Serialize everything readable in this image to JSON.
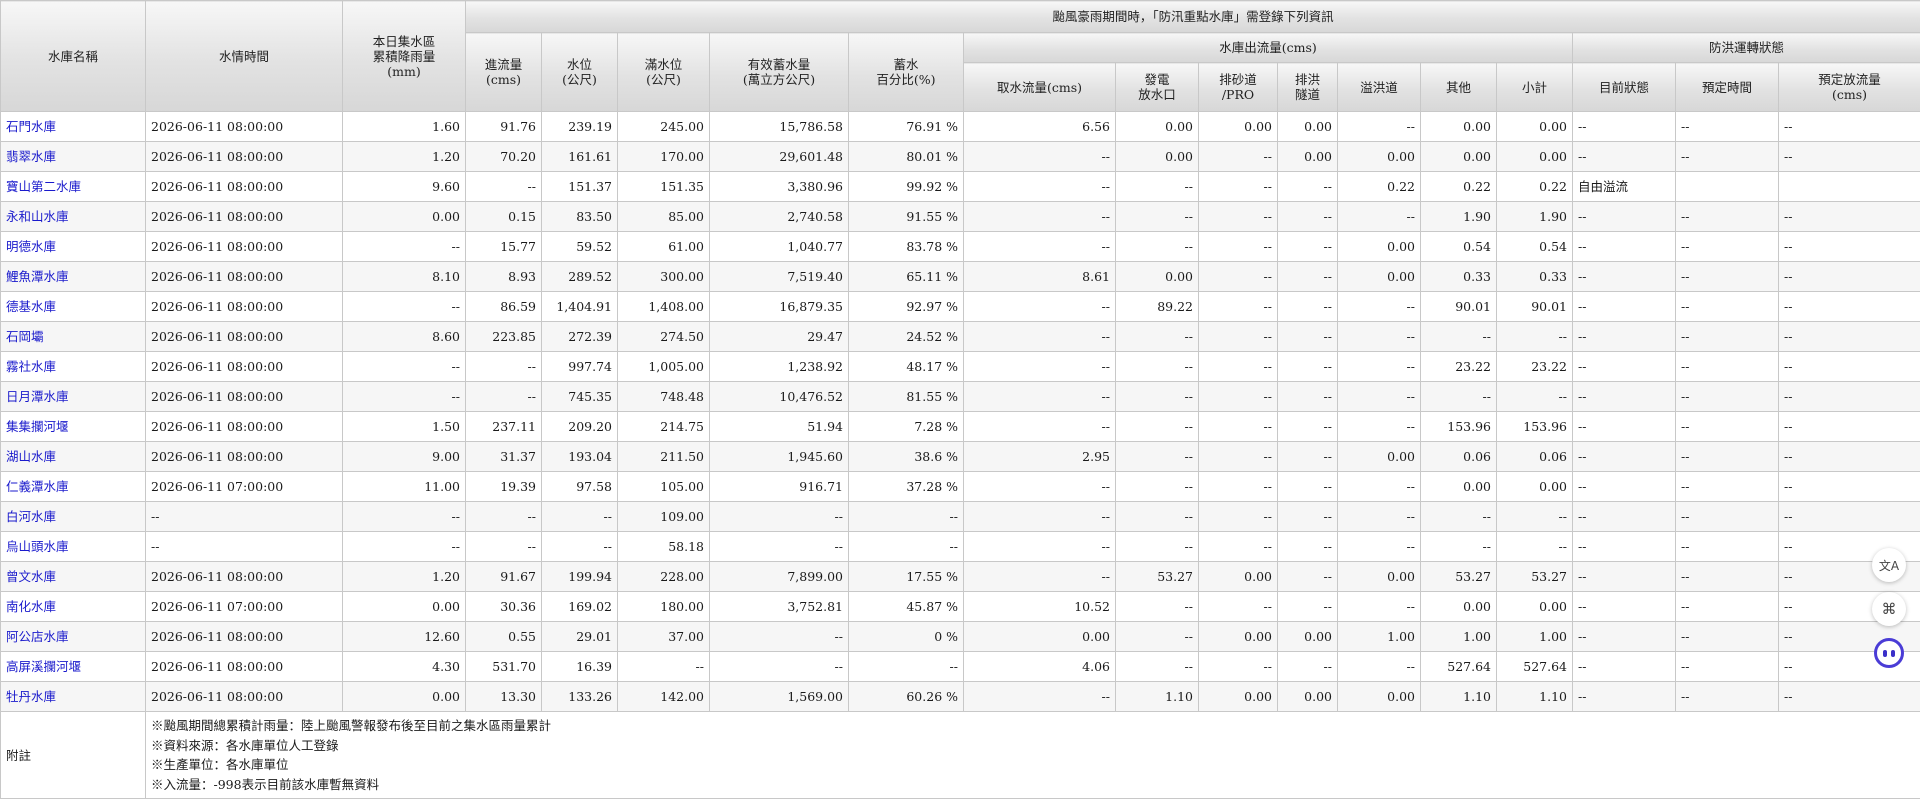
{
  "header": {
    "reservoir_name": "水庫名稱",
    "water_time": "水情時間",
    "rainfall": "本日集水區\n累積降雨量\n(mm)",
    "typhoon_banner": "颱風豪雨期間時，「防汛重點水庫」需登錄下列資訊",
    "inflow": "進流量\n(cms)",
    "water_level": "水位\n(公尺)",
    "full_level": "滿水位\n(公尺)",
    "effective_storage": "有效蓄水量\n(萬立方公尺)",
    "storage_pct": "蓄水\n百分比(%)",
    "outflow_group": "水庫出流量(cms)",
    "intake_flow": "取水流量(cms)",
    "power_outlet": "發電\n放水口",
    "sediment_pro": "排砂道\n/PRO",
    "flood_tunnel": "排洪\n隧道",
    "spillway": "溢洪道",
    "others": "其他",
    "subtotal": "小計",
    "flood_ops_group": "防洪運轉狀態",
    "current_status": "目前狀態",
    "scheduled_time": "預定時間",
    "scheduled_discharge": "預定放流量\n(cms)"
  },
  "rows": [
    {
      "name": "石門水庫",
      "time": "2026-06-11 08:00:00",
      "rain": "1.60",
      "inflow": "91.76",
      "level": "239.19",
      "full": "245.00",
      "storage": "15,786.58",
      "pct": "76.91 %",
      "intake": "6.56",
      "power": "0.00",
      "sediment": "0.00",
      "tunnel": "0.00",
      "spill": "--",
      "other": "0.00",
      "subtotal": "0.00",
      "status": "--",
      "sched_time": "--",
      "sched_flow": "--"
    },
    {
      "name": "翡翠水庫",
      "time": "2026-06-11 08:00:00",
      "rain": "1.20",
      "inflow": "70.20",
      "level": "161.61",
      "full": "170.00",
      "storage": "29,601.48",
      "pct": "80.01 %",
      "intake": "--",
      "power": "0.00",
      "sediment": "--",
      "tunnel": "0.00",
      "spill": "0.00",
      "other": "0.00",
      "subtotal": "0.00",
      "status": "--",
      "sched_time": "--",
      "sched_flow": "--"
    },
    {
      "name": "寶山第二水庫",
      "time": "2026-06-11 08:00:00",
      "rain": "9.60",
      "inflow": "--",
      "level": "151.37",
      "full": "151.35",
      "storage": "3,380.96",
      "pct": "99.92 %",
      "intake": "--",
      "power": "--",
      "sediment": "--",
      "tunnel": "--",
      "spill": "0.22",
      "other": "0.22",
      "subtotal": "0.22",
      "status": "自由溢流",
      "sched_time": "",
      "sched_flow": ""
    },
    {
      "name": "永和山水庫",
      "time": "2026-06-11 08:00:00",
      "rain": "0.00",
      "inflow": "0.15",
      "level": "83.50",
      "full": "85.00",
      "storage": "2,740.58",
      "pct": "91.55 %",
      "intake": "--",
      "power": "--",
      "sediment": "--",
      "tunnel": "--",
      "spill": "--",
      "other": "1.90",
      "subtotal": "1.90",
      "status": "--",
      "sched_time": "--",
      "sched_flow": "--"
    },
    {
      "name": "明德水庫",
      "time": "2026-06-11 08:00:00",
      "rain": "--",
      "inflow": "15.77",
      "level": "59.52",
      "full": "61.00",
      "storage": "1,040.77",
      "pct": "83.78 %",
      "intake": "--",
      "power": "--",
      "sediment": "--",
      "tunnel": "--",
      "spill": "0.00",
      "other": "0.54",
      "subtotal": "0.54",
      "status": "--",
      "sched_time": "--",
      "sched_flow": "--"
    },
    {
      "name": "鯉魚潭水庫",
      "time": "2026-06-11 08:00:00",
      "rain": "8.10",
      "inflow": "8.93",
      "level": "289.52",
      "full": "300.00",
      "storage": "7,519.40",
      "pct": "65.11 %",
      "intake": "8.61",
      "power": "0.00",
      "sediment": "--",
      "tunnel": "--",
      "spill": "0.00",
      "other": "0.33",
      "subtotal": "0.33",
      "status": "--",
      "sched_time": "--",
      "sched_flow": "--"
    },
    {
      "name": "德基水庫",
      "time": "2026-06-11 08:00:00",
      "rain": "--",
      "inflow": "86.59",
      "level": "1,404.91",
      "full": "1,408.00",
      "storage": "16,879.35",
      "pct": "92.97 %",
      "intake": "--",
      "power": "89.22",
      "sediment": "--",
      "tunnel": "--",
      "spill": "--",
      "other": "90.01",
      "subtotal": "90.01",
      "status": "--",
      "sched_time": "--",
      "sched_flow": "--"
    },
    {
      "name": "石岡壩",
      "time": "2026-06-11 08:00:00",
      "rain": "8.60",
      "inflow": "223.85",
      "level": "272.39",
      "full": "274.50",
      "storage": "29.47",
      "pct": "24.52 %",
      "intake": "--",
      "power": "--",
      "sediment": "--",
      "tunnel": "--",
      "spill": "--",
      "other": "--",
      "subtotal": "--",
      "status": "--",
      "sched_time": "--",
      "sched_flow": "--"
    },
    {
      "name": "霧社水庫",
      "time": "2026-06-11 08:00:00",
      "rain": "--",
      "inflow": "--",
      "level": "997.74",
      "full": "1,005.00",
      "storage": "1,238.92",
      "pct": "48.17 %",
      "intake": "--",
      "power": "--",
      "sediment": "--",
      "tunnel": "--",
      "spill": "--",
      "other": "23.22",
      "subtotal": "23.22",
      "status": "--",
      "sched_time": "--",
      "sched_flow": "--"
    },
    {
      "name": "日月潭水庫",
      "time": "2026-06-11 08:00:00",
      "rain": "--",
      "inflow": "--",
      "level": "745.35",
      "full": "748.48",
      "storage": "10,476.52",
      "pct": "81.55 %",
      "intake": "--",
      "power": "--",
      "sediment": "--",
      "tunnel": "--",
      "spill": "--",
      "other": "--",
      "subtotal": "--",
      "status": "--",
      "sched_time": "--",
      "sched_flow": "--"
    },
    {
      "name": "集集攔河堰",
      "time": "2026-06-11 08:00:00",
      "rain": "1.50",
      "inflow": "237.11",
      "level": "209.20",
      "full": "214.75",
      "storage": "51.94",
      "pct": "7.28 %",
      "intake": "--",
      "power": "--",
      "sediment": "--",
      "tunnel": "--",
      "spill": "--",
      "other": "153.96",
      "subtotal": "153.96",
      "status": "--",
      "sched_time": "--",
      "sched_flow": "--"
    },
    {
      "name": "湖山水庫",
      "time": "2026-06-11 08:00:00",
      "rain": "9.00",
      "inflow": "31.37",
      "level": "193.04",
      "full": "211.50",
      "storage": "1,945.60",
      "pct": "38.6 %",
      "intake": "2.95",
      "power": "--",
      "sediment": "--",
      "tunnel": "--",
      "spill": "0.00",
      "other": "0.06",
      "subtotal": "0.06",
      "status": "--",
      "sched_time": "--",
      "sched_flow": "--"
    },
    {
      "name": "仁義潭水庫",
      "time": "2026-06-11 07:00:00",
      "rain": "11.00",
      "inflow": "19.39",
      "level": "97.58",
      "full": "105.00",
      "storage": "916.71",
      "pct": "37.28 %",
      "intake": "--",
      "power": "--",
      "sediment": "--",
      "tunnel": "--",
      "spill": "--",
      "other": "0.00",
      "subtotal": "0.00",
      "status": "--",
      "sched_time": "--",
      "sched_flow": "--"
    },
    {
      "name": "白河水庫",
      "time": "--",
      "rain": "--",
      "inflow": "--",
      "level": "--",
      "full": "109.00",
      "storage": "--",
      "pct": "--",
      "intake": "--",
      "power": "--",
      "sediment": "--",
      "tunnel": "--",
      "spill": "--",
      "other": "--",
      "subtotal": "--",
      "status": "--",
      "sched_time": "--",
      "sched_flow": "--"
    },
    {
      "name": "烏山頭水庫",
      "time": "--",
      "rain": "--",
      "inflow": "--",
      "level": "--",
      "full": "58.18",
      "storage": "--",
      "pct": "--",
      "intake": "--",
      "power": "--",
      "sediment": "--",
      "tunnel": "--",
      "spill": "--",
      "other": "--",
      "subtotal": "--",
      "status": "--",
      "sched_time": "--",
      "sched_flow": "--"
    },
    {
      "name": "曾文水庫",
      "time": "2026-06-11 08:00:00",
      "rain": "1.20",
      "inflow": "91.67",
      "level": "199.94",
      "full": "228.00",
      "storage": "7,899.00",
      "pct": "17.55 %",
      "intake": "--",
      "power": "53.27",
      "sediment": "0.00",
      "tunnel": "--",
      "spill": "0.00",
      "other": "53.27",
      "subtotal": "53.27",
      "status": "--",
      "sched_time": "--",
      "sched_flow": "--"
    },
    {
      "name": "南化水庫",
      "time": "2026-06-11 07:00:00",
      "rain": "0.00",
      "inflow": "30.36",
      "level": "169.02",
      "full": "180.00",
      "storage": "3,752.81",
      "pct": "45.87 %",
      "intake": "10.52",
      "power": "--",
      "sediment": "--",
      "tunnel": "--",
      "spill": "--",
      "other": "0.00",
      "subtotal": "0.00",
      "status": "--",
      "sched_time": "--",
      "sched_flow": "--"
    },
    {
      "name": "阿公店水庫",
      "time": "2026-06-11 08:00:00",
      "rain": "12.60",
      "inflow": "0.55",
      "level": "29.01",
      "full": "37.00",
      "storage": "--",
      "pct": "0 %",
      "intake": "0.00",
      "power": "--",
      "sediment": "0.00",
      "tunnel": "0.00",
      "spill": "1.00",
      "other": "1.00",
      "subtotal": "1.00",
      "status": "--",
      "sched_time": "--",
      "sched_flow": "--"
    },
    {
      "name": "高屏溪攔河堰",
      "time": "2026-06-11 08:00:00",
      "rain": "4.30",
      "inflow": "531.70",
      "level": "16.39",
      "full": "--",
      "storage": "--",
      "pct": "--",
      "intake": "4.06",
      "power": "--",
      "sediment": "--",
      "tunnel": "--",
      "spill": "--",
      "other": "527.64",
      "subtotal": "527.64",
      "status": "--",
      "sched_time": "--",
      "sched_flow": "--"
    },
    {
      "name": "牡丹水庫",
      "time": "2026-06-11 08:00:00",
      "rain": "0.00",
      "inflow": "13.30",
      "level": "133.26",
      "full": "142.00",
      "storage": "1,569.00",
      "pct": "60.26 %",
      "intake": "--",
      "power": "1.10",
      "sediment": "0.00",
      "tunnel": "0.00",
      "spill": "0.00",
      "other": "1.10",
      "subtotal": "1.10",
      "status": "--",
      "sched_time": "--",
      "sched_flow": "--"
    }
  ],
  "notes": {
    "label": "附註",
    "lines": [
      "※颱風期間總累積計雨量：陸上颱風警報發布後至目前之集水區雨量累計",
      "※資料來源：各水庫單位人工登錄",
      "※生產單位：各水庫單位",
      "※入流量：-998表示目前該水庫暫無資料"
    ]
  },
  "side_tools": [
    {
      "name": "translate-icon",
      "glyph": "文A"
    },
    {
      "name": "grid-apps-icon",
      "glyph": "⌘"
    }
  ]
}
